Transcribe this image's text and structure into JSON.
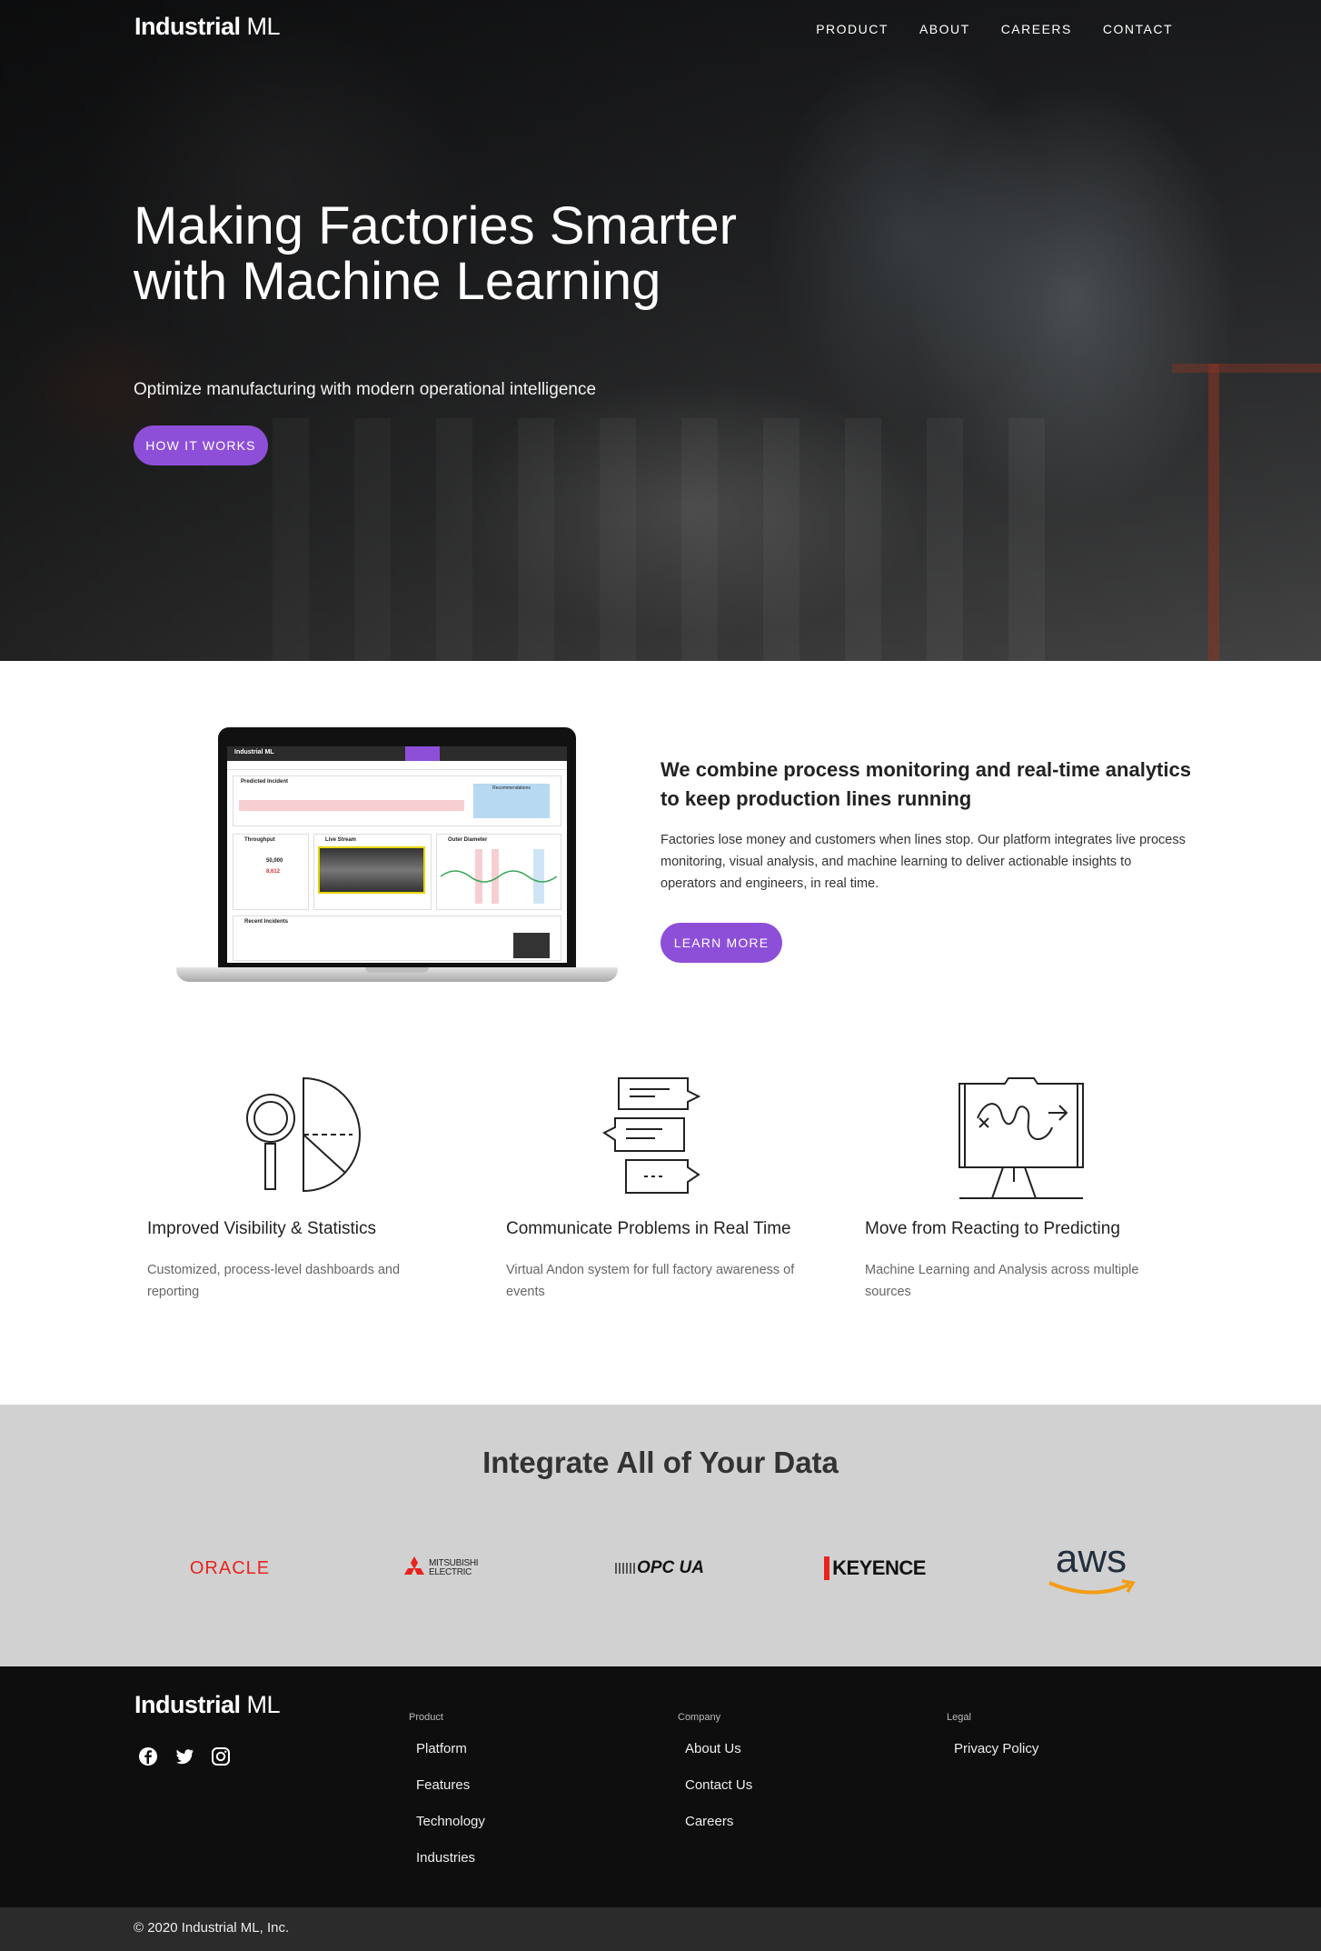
{
  "brand": {
    "bold": "Industrial",
    "light": "ML"
  },
  "nav": {
    "items": [
      "PRODUCT",
      "ABOUT",
      "CAREERS",
      "CONTACT"
    ]
  },
  "hero": {
    "title": "Making Factories Smarter with Machine Learning",
    "subtitle": "Optimize manufacturing with modern operational intelligence",
    "cta": "HOW IT WORKS"
  },
  "feature": {
    "heading": "We combine process monitoring and real-time analytics to keep production lines running",
    "text": "Factories lose money and customers when lines stop. Our platform integrates live process monitoring, visual analysis, and machine learning to deliver actionable insights to operators and engineers, in real time.",
    "cta": "LEARN MORE",
    "dashboard": {
      "app_title": "Industrial ML",
      "predicted_incident": "Predicted Incident",
      "recommendations": "Recommendations",
      "throughput": "Throughput",
      "live_stream": "Live Stream",
      "outer_diameter": "Outer Diameter",
      "recent_incidents": "Recent Incidents",
      "meters_cut": "50,000",
      "actual": "8,612"
    }
  },
  "columns": [
    {
      "icon": "magnifier-pie-chart-icon",
      "title": "Improved Visibility & Statistics",
      "text": "Customized, process-level dashboards and reporting"
    },
    {
      "icon": "chat-bubbles-icon",
      "title": "Communicate Problems in Real Time",
      "text": "Virtual Andon system for full factory awareness of events"
    },
    {
      "icon": "whiteboard-plan-icon",
      "title": "Move from Reacting to Predicting",
      "text": "Machine Learning and Analysis across multiple sources"
    }
  ],
  "integrations": {
    "title": "Integrate All of Your Data",
    "logos": [
      "ORACLE",
      "MITSUBISHI ELECTRIC",
      "OPC UA",
      "KEYENCE",
      "aws"
    ]
  },
  "footer": {
    "columns": [
      {
        "heading": "Product",
        "links": [
          "Platform",
          "Features",
          "Technology",
          "Industries"
        ]
      },
      {
        "heading": "Company",
        "links": [
          "About Us",
          "Contact Us",
          "Careers"
        ]
      },
      {
        "heading": "Legal",
        "links": [
          "Privacy Policy"
        ]
      }
    ],
    "social": [
      "facebook-icon",
      "twitter-icon",
      "instagram-icon"
    ],
    "copyright": "© 2020 Industrial ML, Inc."
  },
  "colors": {
    "accent": "#8e4fd8",
    "footer_bg": "#0e0e0e",
    "integrations_bg": "#d1d1d1",
    "oracle_red": "#e8231e",
    "aws_orange": "#f39c12"
  }
}
